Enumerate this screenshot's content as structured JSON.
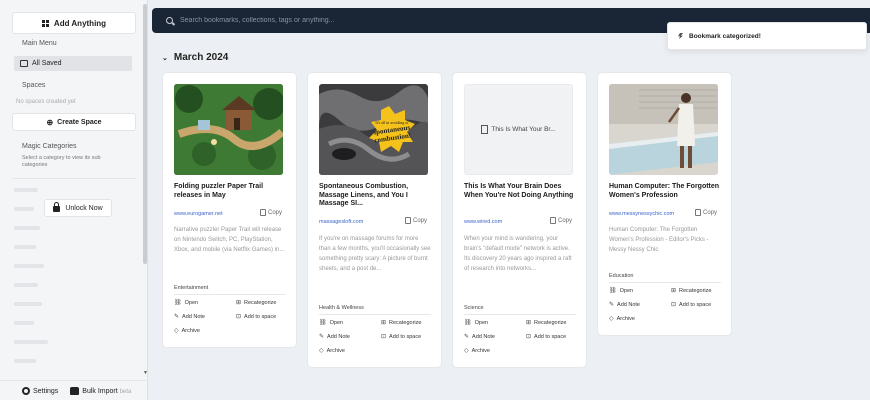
{
  "sidebar": {
    "add_label": "Add Anything",
    "main_menu_label": "Main Menu",
    "all_saved_label": "All Saved",
    "spaces_label": "Spaces",
    "no_spaces_label": "No spaces created yet",
    "create_space_label": "Create Space",
    "magic_categories_label": "Magic Categories",
    "magic_categories_hint": "Select a category to view its sub categories",
    "unlock_label": "Unlock Now",
    "settings_label": "Settings",
    "bulk_import_label": "Bulk Import",
    "beta_label": "beta"
  },
  "search": {
    "placeholder": "Search bookmarks, collections, tags or anything..."
  },
  "section": {
    "title": "March 2024"
  },
  "toast": {
    "message": "Bookmark categorized!"
  },
  "actions": {
    "open": "Open",
    "recategorize": "Recategorize",
    "add_note": "Add Note",
    "add_to_space": "Add to space",
    "archive": "Archive",
    "copy": "Copy"
  },
  "cards": [
    {
      "title": "Folding puzzler Paper Trail releases in May",
      "domain": "www.eurogamer.net",
      "description": "Narrative puzzler Paper Trail will release on Nintendo Switch, PC, PlayStation, Xbox, and mobile (via Netflix Games) in...",
      "tag": "Entertainment"
    },
    {
      "title": "Spontaneous Combustion, Massage Linens, and You I Massage SI...",
      "domain": "massagesloft.com",
      "description": "If you're on massage forums for more than a few months, you'll occasionally see something pretty scary: A picture of burnt sheets, and a post de...",
      "tag": "Health & Wellness",
      "image_text_small": "It's all in avoiding of",
      "image_text_large1": "spontaneous",
      "image_text_large2": "combustion!"
    },
    {
      "title": "This Is What Your Brain Does When You're Not Doing Anything",
      "domain": "www.wired.com",
      "description": "When your mind is wandering, your brain's \"default mode\" network is active. Its discovery 20 years ago inspired a raft of research into networks...",
      "tag": "Science",
      "placeholder_text": "This Is What Your Br..."
    },
    {
      "title": "Human Computer: The Forgotten Women's Profession",
      "domain": "www.messynessychic.com",
      "description": "Human Computer: The Forgotten Women's Profession - Editor's Picks - Messy Nessy Chic",
      "tag": "Education"
    }
  ],
  "colors": {
    "topbar": "#1a2536",
    "link": "#3a63c9",
    "sticker": "#f4c21b"
  }
}
